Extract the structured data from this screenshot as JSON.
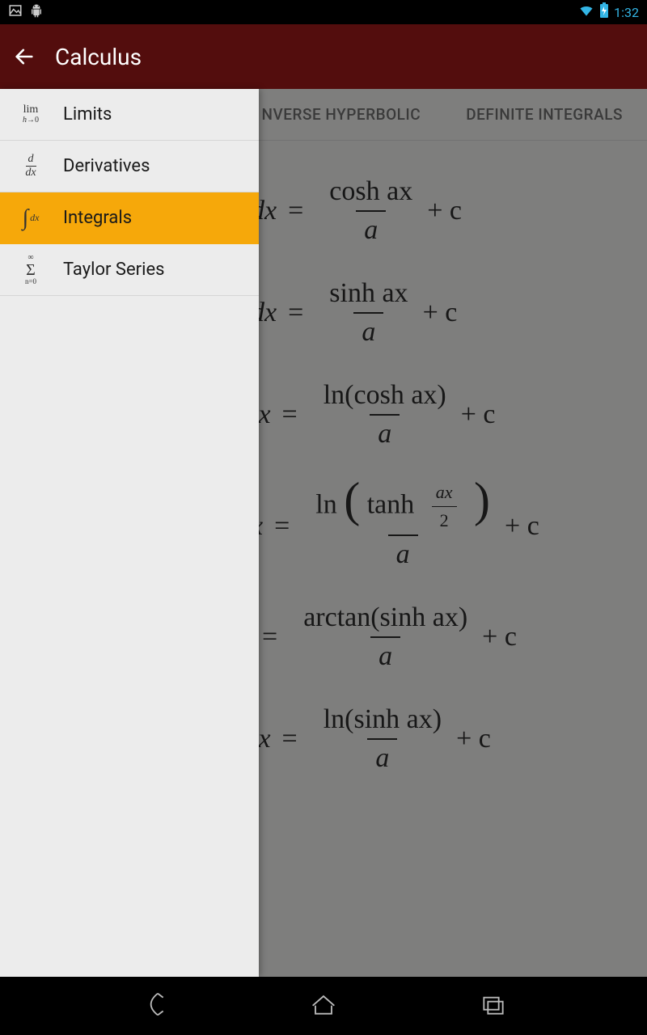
{
  "status": {
    "time": "1:32"
  },
  "appbar": {
    "title": "Calculus"
  },
  "drawer": {
    "items": [
      {
        "label": "Limits"
      },
      {
        "label": "Derivatives"
      },
      {
        "label": "Integrals"
      },
      {
        "label": "Taylor Series"
      }
    ],
    "selected_index": 2
  },
  "tabs": {
    "visible": [
      {
        "label": "NVERSE HYPERBOLIC"
      },
      {
        "label": "DEFINITE INTEGRALS"
      }
    ]
  },
  "formulas": [
    {
      "lhs_tail": "dx",
      "rhs_num": "cosh ax",
      "rhs_den": "a",
      "plus_c": "+ c"
    },
    {
      "lhs_tail": "dx",
      "rhs_num": "sinh ax",
      "rhs_den": "a",
      "plus_c": "+ c"
    },
    {
      "lhs_tail": "lx",
      "rhs_num": "ln(cosh ax)",
      "rhs_den": "a",
      "plus_c": "+ c"
    },
    {
      "lhs_tail": "x",
      "rhs_num_prefix": "ln",
      "rhs_num_inner": "tanh",
      "rhs_num_frac_num": "ax",
      "rhs_num_frac_den": "2",
      "rhs_den": "a",
      "plus_c": "+ c"
    },
    {
      "lhs_tail": "",
      "rhs_num": "arctan(sinh ax)",
      "rhs_den": "a",
      "plus_c": "+ c"
    },
    {
      "lhs_tail": "lx",
      "rhs_num": "ln(sinh ax)",
      "rhs_den": "a",
      "plus_c": "+ c"
    }
  ]
}
